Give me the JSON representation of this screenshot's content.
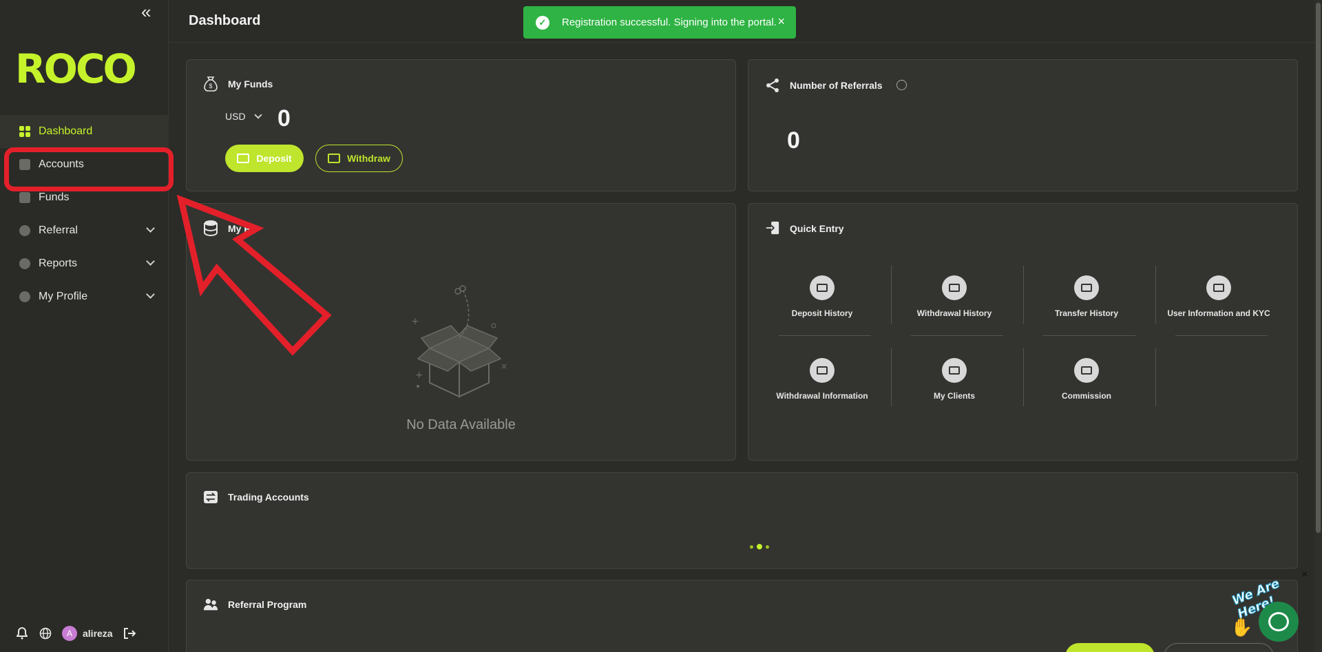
{
  "app": {
    "logo": "ROCO",
    "accent": "#c5f22b"
  },
  "sidebar": {
    "collapse_icon": "«",
    "items": [
      {
        "label": "Dashboard",
        "icon": "grid-icon",
        "active": true
      },
      {
        "label": "Accounts",
        "icon": "accounts-icon"
      },
      {
        "label": "Funds",
        "icon": "wallet-icon"
      },
      {
        "label": "Referral",
        "icon": "referral-icon",
        "expandable": true
      },
      {
        "label": "Reports",
        "icon": "pie-chart-icon",
        "expandable": true
      },
      {
        "label": "My Profile",
        "icon": "user-icon",
        "expandable": true
      }
    ],
    "footer": {
      "avatar_letter": "A",
      "username": "alireza"
    }
  },
  "header": {
    "title": "Dashboard"
  },
  "toast": {
    "message": "Registration successful. Signing into the portal.",
    "close": "×",
    "color": "#2fb344"
  },
  "funds_card": {
    "title": "My Funds",
    "currency": "USD",
    "balance": "0",
    "deposit_label": "Deposit",
    "withdraw_label": "Withdraw"
  },
  "referrals_card": {
    "title": "Number of Referrals",
    "count": "0"
  },
  "funds_chart_card": {
    "title": "My Fu",
    "empty_text": "No Data Available"
  },
  "quick_entry": {
    "title": "Quick Entry",
    "items": [
      "Deposit History",
      "Withdrawal History",
      "Transfer History",
      "User Information and KYC",
      "Withdrawal Information",
      "My Clients",
      "Commission"
    ]
  },
  "trading_accounts": {
    "title": "Trading Accounts"
  },
  "referral_program": {
    "title": "Referral Program"
  },
  "chat_widget": {
    "badge": "We Are Here!",
    "close": "×"
  }
}
